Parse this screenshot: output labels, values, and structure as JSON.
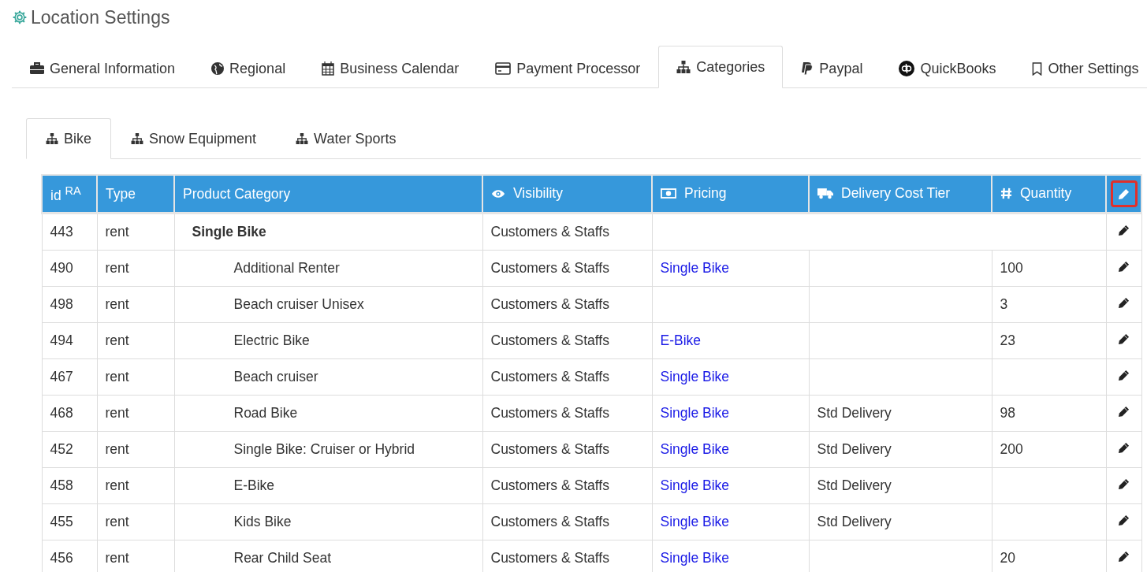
{
  "page": {
    "title": "Location Settings"
  },
  "tabs": [
    {
      "label": "General Information",
      "selected": false
    },
    {
      "label": "Regional",
      "selected": false
    },
    {
      "label": "Business Calendar",
      "selected": false
    },
    {
      "label": "Payment Processor",
      "selected": false
    },
    {
      "label": "Categories",
      "selected": true
    },
    {
      "label": "Paypal",
      "selected": false
    },
    {
      "label": "QuickBooks",
      "selected": false
    },
    {
      "label": "Other Settings",
      "selected": false
    }
  ],
  "subtabs": [
    {
      "label": "Bike",
      "selected": true
    },
    {
      "label": "Snow Equipment",
      "selected": false
    },
    {
      "label": "Water Sports",
      "selected": false
    }
  ],
  "table": {
    "columns": [
      "id $^{RA}$",
      "Type",
      "Product Category",
      "Visibility",
      "Pricing",
      "Delivery Cost Tier",
      "Quantity"
    ],
    "edit_column": {
      "highlighted": true
    },
    "rows": [
      {
        "id": "443",
        "type": "rent",
        "category": "Single Bike",
        "visibility": "Customers & Staffs",
        "children": [
          {
            "id": "490",
            "type": "rent",
            "category": "Additional Renter",
            "visibility": "Customers & Staffs",
            "pricing": "Single Bike",
            "quantity": "100"
          },
          {
            "id": "498",
            "type": "rent",
            "category": "Beach cruiser Unisex",
            "visibility": "Customers & Staffs",
            "quantity": "3"
          },
          {
            "id": "494",
            "type": "rent",
            "category": "Electric Bike",
            "visibility": "Customers & Staffs",
            "pricing": "E-Bike",
            "quantity": "23"
          },
          {
            "id": "467",
            "type": "rent",
            "category": "Beach cruiser",
            "visibility": "Customers & Staffs",
            "pricing": "Single Bike"
          },
          {
            "id": "468",
            "type": "rent",
            "category": "Road Bike",
            "visibility": "Customers & Staffs",
            "pricing": "Single Bike",
            "delivery": "Std Delivery",
            "quantity": "98"
          },
          {
            "id": "452",
            "type": "rent",
            "category": "Single Bike: Cruiser or Hybrid",
            "visibility": "Customers & Staffs",
            "pricing": "Single Bike",
            "delivery": "Std Delivery",
            "quantity": "200"
          },
          {
            "id": "458",
            "type": "rent",
            "category": "E-Bike",
            "visibility": "Customers & Staffs",
            "pricing": "Single Bike",
            "delivery": "Std Delivery"
          },
          {
            "id": "455",
            "type": "rent",
            "category": "Kids Bike",
            "visibility": "Customers & Staffs",
            "pricing": "Single Bike",
            "delivery": "Std Delivery"
          },
          {
            "id": "456",
            "type": "rent",
            "category": "Rear Child Seat",
            "visibility": "Customers & Staffs",
            "pricing": "Single Bike",
            "quantity": "20"
          }
        ]
      }
    ]
  }
}
